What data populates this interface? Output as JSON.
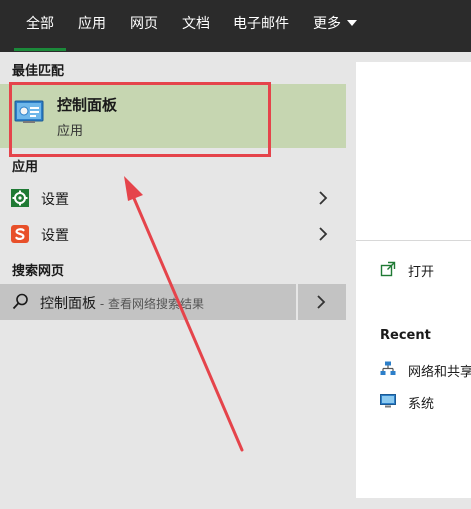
{
  "nav": {
    "tabs": [
      {
        "label": "全部"
      },
      {
        "label": "应用"
      },
      {
        "label": "网页"
      },
      {
        "label": "文档"
      },
      {
        "label": "电子邮件"
      },
      {
        "label": "更多"
      }
    ],
    "active_index": 0,
    "accent_color": "#1b8a3a"
  },
  "results": {
    "best_match_heading": "最佳匹配",
    "best_match": {
      "title": "控制面板",
      "subtitle": "应用",
      "icon": "control-panel-icon"
    },
    "apps_heading": "应用",
    "apps": [
      {
        "label": "设置",
        "icon": "settings-gear-icon"
      },
      {
        "label": "设置",
        "icon": "sogou-settings-icon"
      }
    ],
    "web_heading": "搜索网页",
    "web_result": {
      "query": "控制面板",
      "hint": " - 查看网络搜索结果",
      "icon": "search-icon"
    }
  },
  "detail": {
    "open_label": "打开",
    "recent_heading": "Recent",
    "recent_items": [
      {
        "label": "网络和共享",
        "icon": "network-icon"
      },
      {
        "label": "系统",
        "icon": "system-monitor-icon"
      }
    ]
  },
  "annotation": {
    "highlight_color": "#e5444b"
  }
}
